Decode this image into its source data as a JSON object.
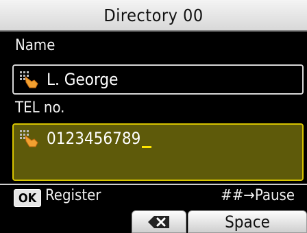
{
  "header": {
    "title": "Directory 00"
  },
  "name_field": {
    "label": "Name",
    "value": "L. George"
  },
  "tel_field": {
    "label": "TEL no.",
    "value": "0123456789"
  },
  "footer": {
    "ok_key": "OK",
    "register_label": "Register",
    "pause_hint": "##→Pause",
    "space_label": "Space"
  },
  "icons": {
    "hand": "hand-pointer-icon",
    "backspace": "backspace-icon"
  },
  "colors": {
    "active_field_bg": "#5e5a0a",
    "active_field_border": "#d7c400",
    "cursor": "#ffe600"
  }
}
